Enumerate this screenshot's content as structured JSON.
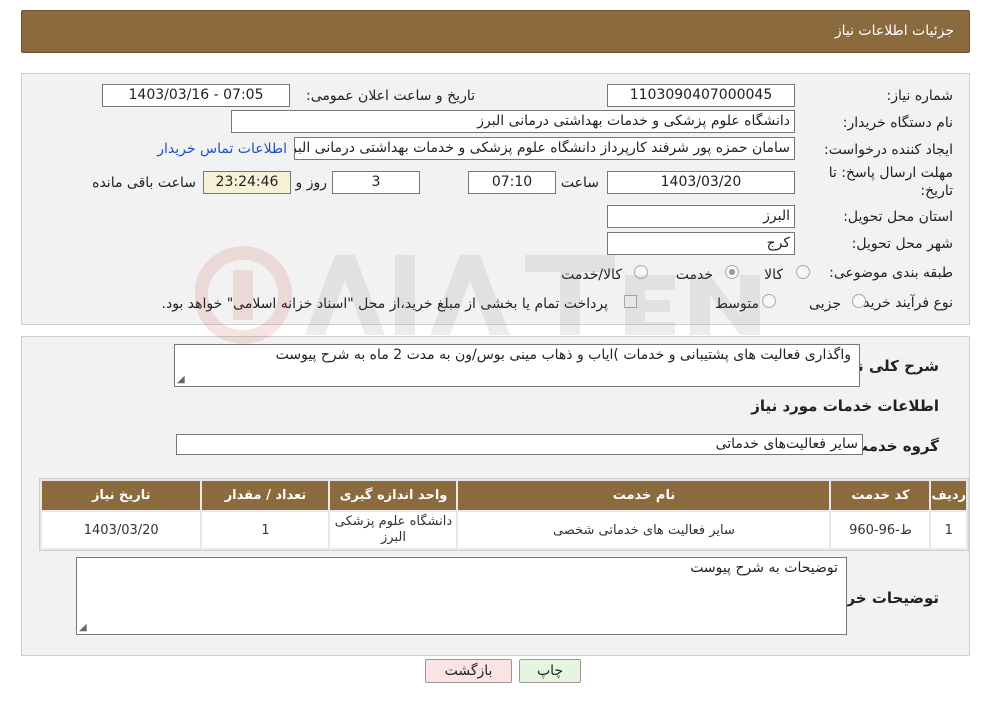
{
  "header": {
    "title": "جزئیات اطلاعات نیاز"
  },
  "form": {
    "need_number": {
      "label": "شماره نیاز:",
      "value": "1103090407000045"
    },
    "announce_datetime": {
      "label": "تاریخ و ساعت اعلان عمومی:",
      "value": "1403/03/16 - 07:05"
    },
    "buyer_org": {
      "label": "نام دستگاه خریدار:",
      "value": "دانشگاه علوم پزشکی و خدمات بهداشتی  درمانی البرز"
    },
    "requester": {
      "label": "ایجاد کننده درخواست:",
      "value": "سامان حمزه پور شرفند کارپرداز دانشگاه علوم پزشکی و خدمات بهداشتی  درمانی البرز",
      "contact_link": "اطلاعات تماس خریدار"
    },
    "deadline": {
      "label_line1": "مهلت ارسال پاسخ: تا",
      "label_line2": "تاریخ:",
      "date": "1403/03/20",
      "time_label": "ساعت",
      "time": "07:10",
      "days": "3",
      "days_label": "روز و",
      "remaining": "23:24:46",
      "remaining_label": "ساعت باقی مانده"
    },
    "province": {
      "label": "استان محل تحویل:",
      "value": "البرز"
    },
    "city": {
      "label": "شهر محل تحویل:",
      "value": "کرج"
    },
    "category": {
      "label": "طبقه بندی موضوعی:",
      "options": [
        "کالا",
        "خدمت",
        "کالا/خدمت"
      ],
      "selected": "خدمت"
    },
    "process": {
      "label": "نوع فرآیند خرید :",
      "options": [
        "جزیی",
        "متوسط"
      ],
      "selected": "",
      "payment_note": "پرداخت تمام یا بخشی از مبلغ خرید،از محل \"اسناد خزانه اسلامی\" خواهد بود."
    }
  },
  "summary": {
    "label": "شرح کلی نیاز:",
    "value": "واگذاری فعالیت های پشتیبانی و خدمات )ایاب و ذهاب مینی بوس/ون به مدت 2 ماه به شرح پیوست"
  },
  "services": {
    "heading": "اطلاعات خدمات مورد نیاز",
    "group_label": "گروه خدمت:",
    "group_value": "سایر فعالیت‌های خدماتی",
    "columns": [
      "ردیف",
      "کد خدمت",
      "نام خدمت",
      "واحد اندازه گیری",
      "تعداد / مقدار",
      "تاریخ نیاز"
    ],
    "rows": [
      {
        "row": "1",
        "code": "ط-96-960",
        "name": "سایر فعالیت های خدماتی شخصی",
        "unit": "دانشگاه علوم پزشکی البرز",
        "qty": "1",
        "date": "1403/03/20"
      }
    ]
  },
  "buyer_notes": {
    "label": "توضیحات خریدار:",
    "value": "توضیحات به شرح پیوست"
  },
  "buttons": {
    "print": "چاپ",
    "back": "بازگشت"
  },
  "colors": {
    "header_bg": "#8b6a3e",
    "print_btn": "#e6f5e0",
    "back_btn": "#fbe3e3",
    "link": "#1a53c5"
  }
}
